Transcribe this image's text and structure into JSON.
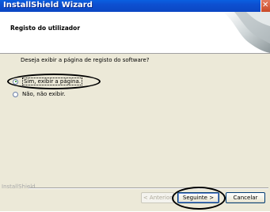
{
  "window": {
    "title": "InstallShield Wizard"
  },
  "header": {
    "title": "Registo do utilizador"
  },
  "content": {
    "question": "Deseja exibir a página de registo do software?",
    "options": [
      {
        "label": "Sim, exibir a página.",
        "selected": true
      },
      {
        "label": "Não, não exibir.",
        "selected": false
      }
    ]
  },
  "footer": {
    "brand": "InstallShield",
    "back_label": "< Anterior",
    "next_label": "Seguinte >",
    "cancel_label": "Cancelar"
  },
  "colors": {
    "titlebar": "#0b4fd0",
    "dialog_bg": "#ece9d8",
    "header_bg": "#ffffff",
    "annotation": "#000000"
  },
  "icons": [
    "close-icon",
    "header-wave-graphic",
    "radio-checked",
    "radio-unchecked"
  ]
}
